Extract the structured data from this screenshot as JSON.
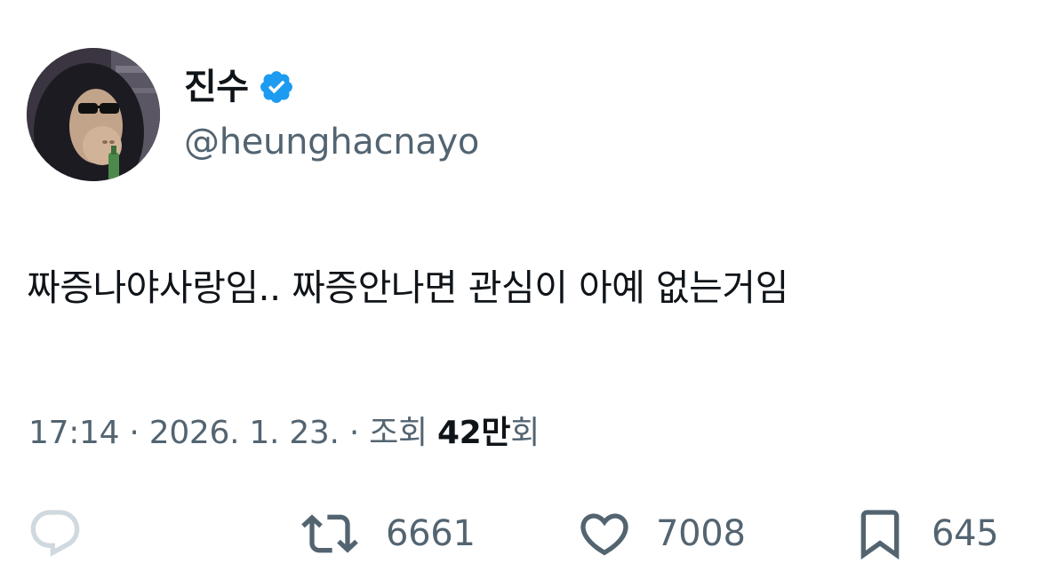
{
  "author": {
    "display_name": "진수",
    "handle": "@heunghacnayo",
    "verified": true,
    "verified_color": "#1d9bf0"
  },
  "tweet": {
    "text": "짜증나야사랑임.. 짜증안나면 관심이 아예 없는거임"
  },
  "meta": {
    "time": "17:14",
    "date": "2026. 1. 23.",
    "views_label": "조회",
    "views_count": "42만",
    "views_suffix": "회",
    "separator": "·"
  },
  "actions": {
    "reply": {
      "icon": "reply-icon",
      "count": ""
    },
    "retweet": {
      "icon": "retweet-icon",
      "count": "6661"
    },
    "like": {
      "icon": "heart-icon",
      "count": "7008"
    },
    "bookmark": {
      "icon": "bookmark-icon",
      "count": "645"
    }
  },
  "colors": {
    "text_primary": "#0f1419",
    "text_secondary": "#536471",
    "background": "#ffffff"
  }
}
